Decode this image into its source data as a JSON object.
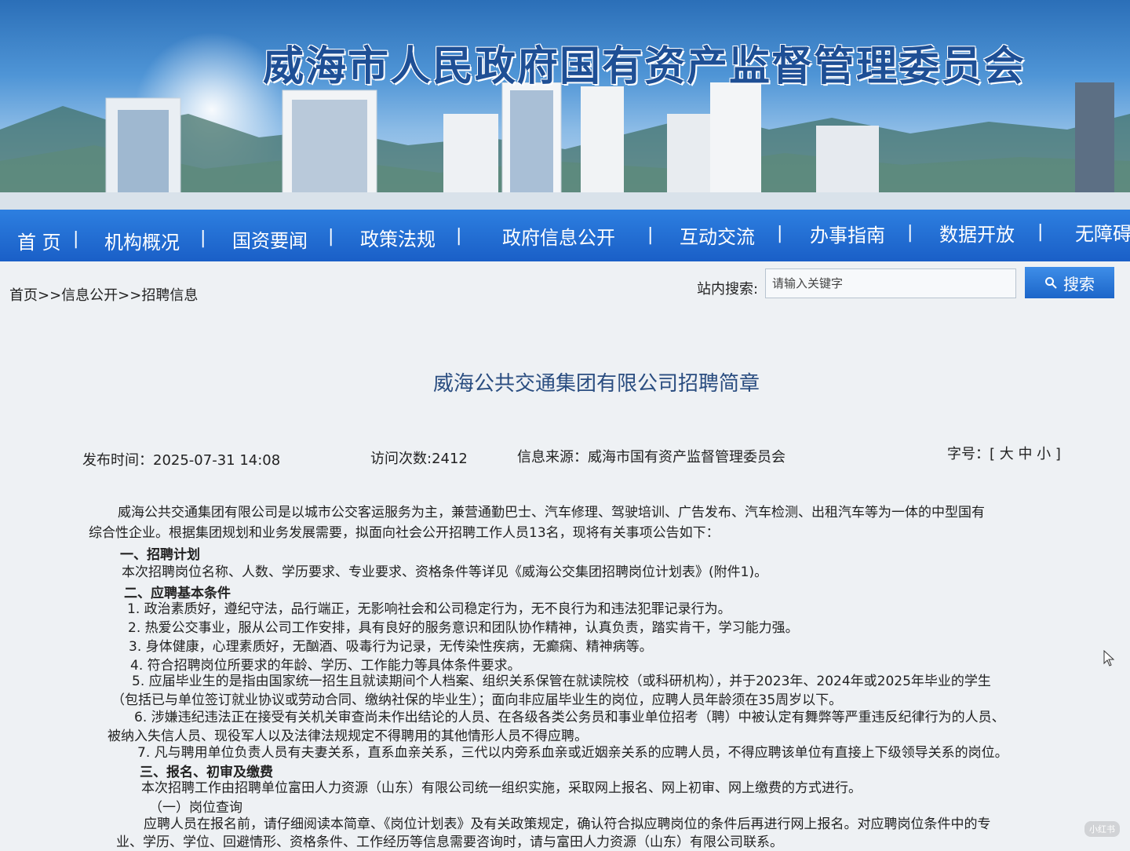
{
  "site_title": "威海市人民政府国有资产监督管理委员会",
  "nav": [
    "首 页",
    "机构概况",
    "国资要闻",
    "政策法规",
    "政府信息公开",
    "互动交流",
    "办事指南",
    "数据开放",
    "无障碍"
  ],
  "breadcrumb": "首页>>信息公开>>招聘信息",
  "search": {
    "label": "站内搜索:",
    "placeholder": "请输入关键字",
    "button": "搜索"
  },
  "article": {
    "title": "威海公共交通集团有限公司招聘简章",
    "publish_time": "发布时间：2025-07-31 14:08",
    "visits": "访问次数:2412",
    "source": "信息来源：威海市国有资产监督管理委员会",
    "font_size": "字号：[ 大 中 小 ]",
    "lines": [
      "威海公共交通集团有限公司是以城市公交客运服务为主，兼营通勤巴士、汽车修理、驾驶培训、广告发布、汽车检测、出租汽车等为一体的中型国有",
      "综合性企业。根据集团规划和业务发展需要，拟面向社会公开招聘工作人员13名，现将有关事项公告如下：",
      "一、招聘计划",
      "本次招聘岗位名称、人数、学历要求、专业要求、资格条件等详见《威海公交集团招聘岗位计划表》(附件1)。",
      "二、应聘基本条件",
      "1. 政治素质好，遵纪守法，品行端正，无影响社会和公司稳定行为，无不良行为和违法犯罪记录行为。",
      "2. 热爱公交事业，服从公司工作安排，具有良好的服务意识和团队协作精神，认真负责，踏实肯干，学习能力强。",
      "3. 身体健康，心理素质好，无酗酒、吸毒行为记录，无传染性疾病，无癫痫、精神病等。",
      "4. 符合招聘岗位所要求的年龄、学历、工作能力等具体条件要求。",
      "5. 应届毕业生的是指由国家统一招生且就读期间个人档案、组织关系保管在就读院校（或科研机构），并于2023年、2024年或2025年毕业的学生",
      "（包括已与单位签订就业协议或劳动合同、缴纳社保的毕业生）；面向非应届毕业生的岗位，应聘人员年龄须在35周岁以下。",
      "6. 涉嫌违纪违法正在接受有关机关审查尚未作出结论的人员、在各级各类公务员和事业单位招考（聘）中被认定有舞弊等严重违反纪律行为的人员、",
      "被纳入失信人员、现役军人以及法律法规规定不得聘用的其他情形人员不得应聘。",
      "7. 凡与聘用单位负责人员有夫妻关系，直系血亲关系，三代以内旁系血亲或近姻亲关系的应聘人员，不得应聘该单位有直接上下级领导关系的岗位。",
      "三、报名、初审及缴费",
      "本次招聘工作由招聘单位富田人力资源（山东）有限公司统一组织实施，采取网上报名、网上初审、网上缴费的方式进行。",
      "（一）岗位查询",
      "应聘人员在报名前，请仔细阅读本简章、《岗位计划表》及有关政策规定，确认符合拟应聘岗位的条件后再进行网上报名。对应聘岗位条件中的专",
      "业、学历、学位、回避情形、资格条件、工作经历等信息需要咨询时，请与富田人力资源（山东）有限公司联系。"
    ]
  },
  "watermark": "小红书"
}
